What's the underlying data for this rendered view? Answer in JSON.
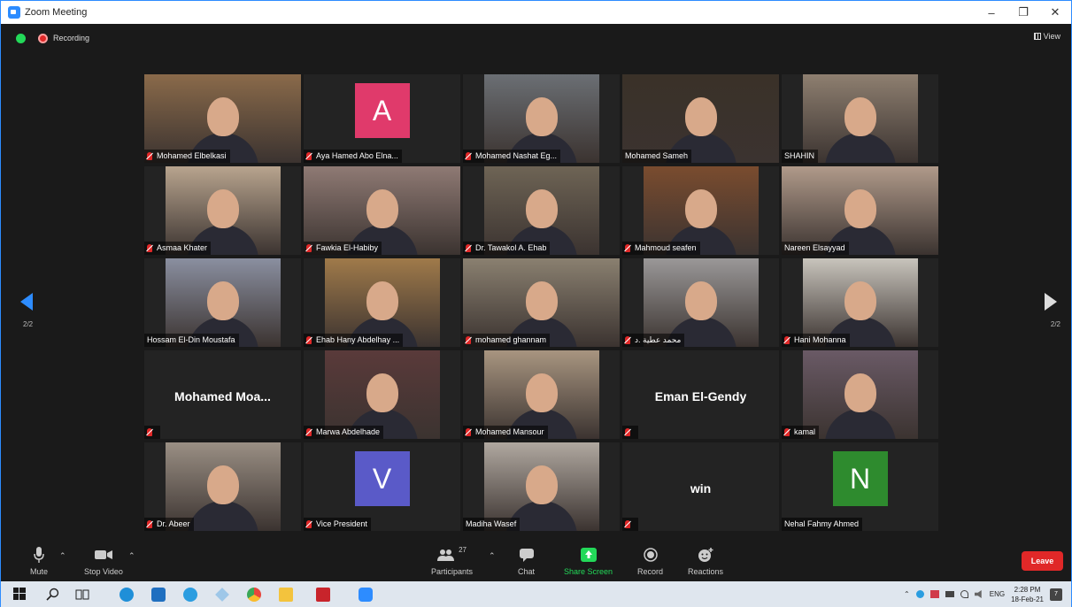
{
  "window": {
    "title": "Zoom Meeting",
    "minimize": "–",
    "maximize": "❐",
    "close": "✕"
  },
  "topbar": {
    "recording": "Recording",
    "view": "View"
  },
  "pagination": {
    "left": "2/2",
    "right": "2/2"
  },
  "tiles": [
    {
      "name": "Mohamed Elbelkasi",
      "type": "video",
      "bg": "#8a6a4a",
      "muted": true
    },
    {
      "name": "Aya Hamed Abo Elna...",
      "type": "avatar",
      "initial": "A",
      "color": "#e03a6b",
      "muted": true
    },
    {
      "name": "Mohamed Nashat Eg...",
      "type": "video",
      "bg": "#6b6f74",
      "muted": true
    },
    {
      "name": "Mohamed Sameh",
      "type": "video",
      "bg": "#3a3128",
      "muted": false
    },
    {
      "name": "SHAHIN",
      "type": "video",
      "bg": "#8e7f70",
      "muted": false
    },
    {
      "name": "Asmaa Khater",
      "type": "video",
      "bg": "#b8a48e",
      "muted": true
    },
    {
      "name": "Fawkia El-Habiby",
      "type": "video",
      "bg": "#8f7a74",
      "muted": true
    },
    {
      "name": "Dr. Tawakol A. Ehab",
      "type": "video",
      "bg": "#6e6455",
      "muted": true
    },
    {
      "name": "Mahmoud seafen",
      "type": "video",
      "bg": "#7a4c2f",
      "muted": true
    },
    {
      "name": "Nareen Elsayyad",
      "type": "video",
      "bg": "#b09a8a",
      "muted": false
    },
    {
      "name": "Hossam El-Din Moustafa",
      "type": "video",
      "bg": "#8a8fa0",
      "muted": false
    },
    {
      "name": "Ehab Hany Abdelhay ...",
      "type": "video",
      "bg": "#a07a4a",
      "muted": true
    },
    {
      "name": "mohamed ghannam",
      "type": "video",
      "bg": "#8a8070",
      "muted": true
    },
    {
      "name": "محمد عطية .د",
      "type": "video",
      "bg": "#9a9898",
      "muted": true
    },
    {
      "name": "Hani Mohanna",
      "type": "video",
      "bg": "#c8c4bc",
      "muted": true
    },
    {
      "name": "",
      "type": "name",
      "bigname": "Mohamed  Moa...",
      "muted": true
    },
    {
      "name": "Marwa Abdelhade",
      "type": "video",
      "bg": "#5a3a3a",
      "muted": true
    },
    {
      "name": "Mohamed Mansour",
      "type": "video",
      "bg": "#a89580",
      "muted": true
    },
    {
      "name": "",
      "type": "name",
      "bigname": "Eman El-Gendy",
      "muted": true
    },
    {
      "name": "kamal",
      "type": "video",
      "bg": "#6a5a66",
      "muted": true
    },
    {
      "name": "Dr. Abeer",
      "type": "video",
      "bg": "#9a8f84",
      "muted": true
    },
    {
      "name": "Vice President",
      "type": "avatar",
      "initial": "V",
      "color": "#5a5ac8",
      "muted": true
    },
    {
      "name": "Madiha Wasef",
      "type": "video",
      "bg": "#b0a8a0",
      "muted": false
    },
    {
      "name": "",
      "type": "name",
      "bigname": "win",
      "muted": true
    },
    {
      "name": "Nehal Fahmy Ahmed",
      "type": "avatar",
      "initial": "N",
      "color": "#2e8b2e",
      "muted": false
    }
  ],
  "toolbar": {
    "mute": "Mute",
    "stop_video": "Stop Video",
    "participants": "Participants",
    "participant_count": "27",
    "chat": "Chat",
    "share_screen": "Share Screen",
    "record": "Record",
    "reactions": "Reactions",
    "leave": "Leave"
  },
  "taskbar": {
    "lang": "ENG",
    "time": "2:28 PM",
    "date": "18-Feb-21",
    "notif": "7"
  }
}
